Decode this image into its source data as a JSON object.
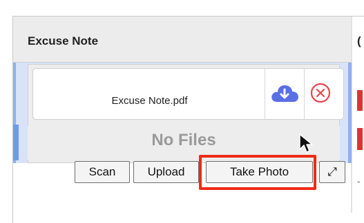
{
  "table": {
    "column_header": "Excuse Note",
    "next_column_header_fragment": "("
  },
  "attachment": {
    "file_name": "Excuse Note.pdf",
    "download_icon": "cloud-download-icon",
    "remove_icon": "circle-x-icon"
  },
  "empty_state": {
    "text": "No Files"
  },
  "actions": {
    "scan_label": "Scan",
    "upload_label": "Upload",
    "take_photo_label": "Take Photo",
    "expand_label": "⤢"
  },
  "colors": {
    "row_selection": "#d8e3fa",
    "download_icon": "#5a6ee6",
    "remove_icon": "#e8454f",
    "highlight": "#ee2b16",
    "status_marker": "#dd3333"
  },
  "misc": {
    "trailing_mark": "-"
  }
}
